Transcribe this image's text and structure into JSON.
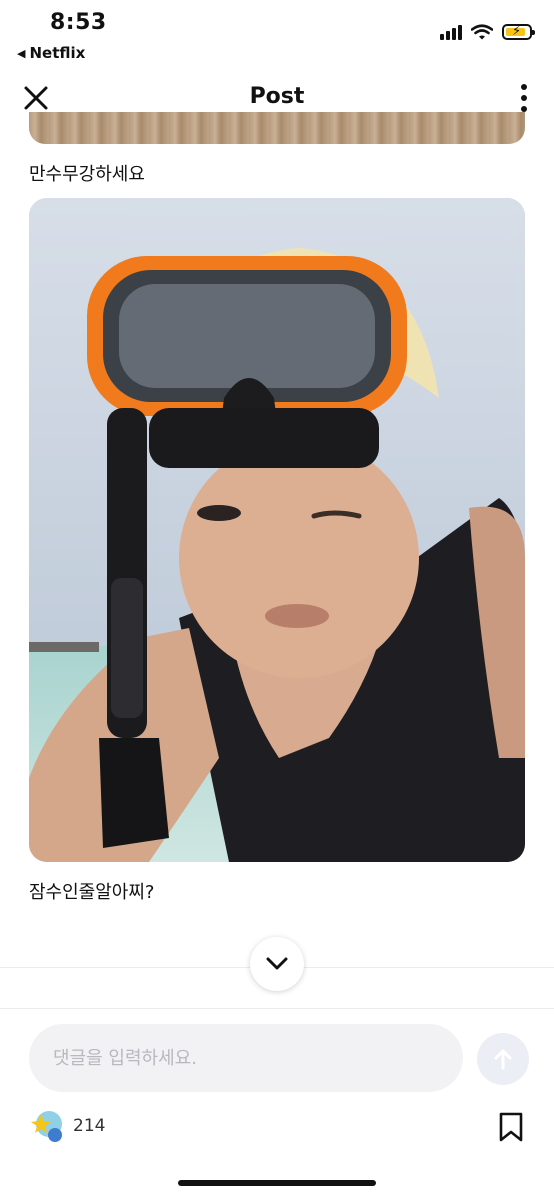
{
  "status_bar": {
    "time": "8:53",
    "back_app": "Netflix",
    "back_icon": "triangle-left-icon",
    "icons": [
      "cellular-signal-icon",
      "wifi-icon",
      "battery-charging-icon"
    ],
    "battery_color": "#f5c518"
  },
  "header": {
    "title": "Post",
    "close_icon": "close-icon",
    "more_icon": "more-vertical-icon"
  },
  "post": {
    "caption_1": "만수무강하세요",
    "photo_description": "selfie with orange snorkel mask",
    "caption_2": "잠수인줄알아찌?"
  },
  "comment": {
    "placeholder": "댓글을 입력하세요.",
    "value": "",
    "send_icon": "arrow-up-icon",
    "send_color": "#eceef6"
  },
  "footer": {
    "reaction_icon": "reaction-emoji-icon",
    "reaction_count": "214",
    "bookmark_icon": "bookmark-icon"
  },
  "scroll_icon": "chevron-down-icon"
}
